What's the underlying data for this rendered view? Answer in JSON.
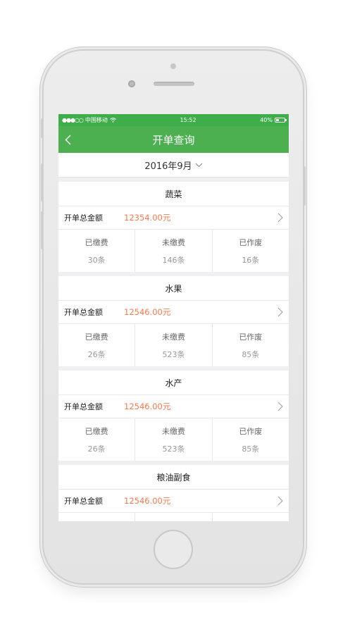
{
  "status_bar": {
    "signal": "●●●○○",
    "carrier": "中国移动",
    "time": "15:52",
    "battery_text": "40%",
    "battery_level": 0.4
  },
  "nav": {
    "title": "开单查询"
  },
  "date_filter": {
    "value": "2016年9月"
  },
  "colors": {
    "primary": "#4caf50",
    "amount": "#f07a4f"
  },
  "sections": [
    {
      "title": "蔬菜",
      "total_label": "开单总金额",
      "total_value": "12354.00元",
      "stats": [
        {
          "label": "已缴费",
          "value": "30条"
        },
        {
          "label": "未缴费",
          "value": "146条"
        },
        {
          "label": "已作废",
          "value": "16条"
        }
      ]
    },
    {
      "title": "水果",
      "total_label": "开单总金额",
      "total_value": "12546.00元",
      "stats": [
        {
          "label": "已缴费",
          "value": "26条"
        },
        {
          "label": "未缴费",
          "value": "523条"
        },
        {
          "label": "已作废",
          "value": "85条"
        }
      ]
    },
    {
      "title": "水产",
      "total_label": "开单总金额",
      "total_value": "12546.00元",
      "stats": [
        {
          "label": "已缴费",
          "value": "26条"
        },
        {
          "label": "未缴费",
          "value": "523条"
        },
        {
          "label": "已作废",
          "value": "85条"
        }
      ]
    },
    {
      "title": "粮油副食",
      "total_label": "开单总金额",
      "total_value": "12546.00元"
    }
  ]
}
